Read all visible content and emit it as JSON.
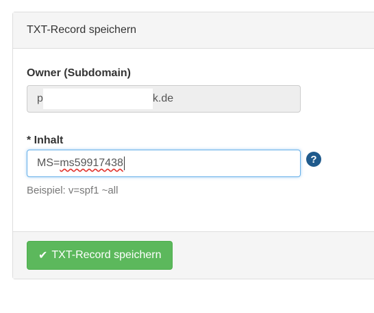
{
  "panel": {
    "title": "TXT-Record speichern"
  },
  "owner": {
    "label": "Owner (Subdomain)",
    "value_prefix": "p",
    "value_suffix": "k.de"
  },
  "content": {
    "label": "* Inhalt",
    "value_prefix": "MS=",
    "value_underlined": "ms59917438",
    "hint": "Beispiel: v=spf1 ~all",
    "help_icon": "question-circle-icon"
  },
  "footer": {
    "submit_icon": "checkmark-icon",
    "submit_label": "TXT-Record speichern"
  },
  "colors": {
    "submit_bg": "#5cb85c",
    "focus_border": "#66afe9",
    "help_icon": "#1f5a8c"
  }
}
